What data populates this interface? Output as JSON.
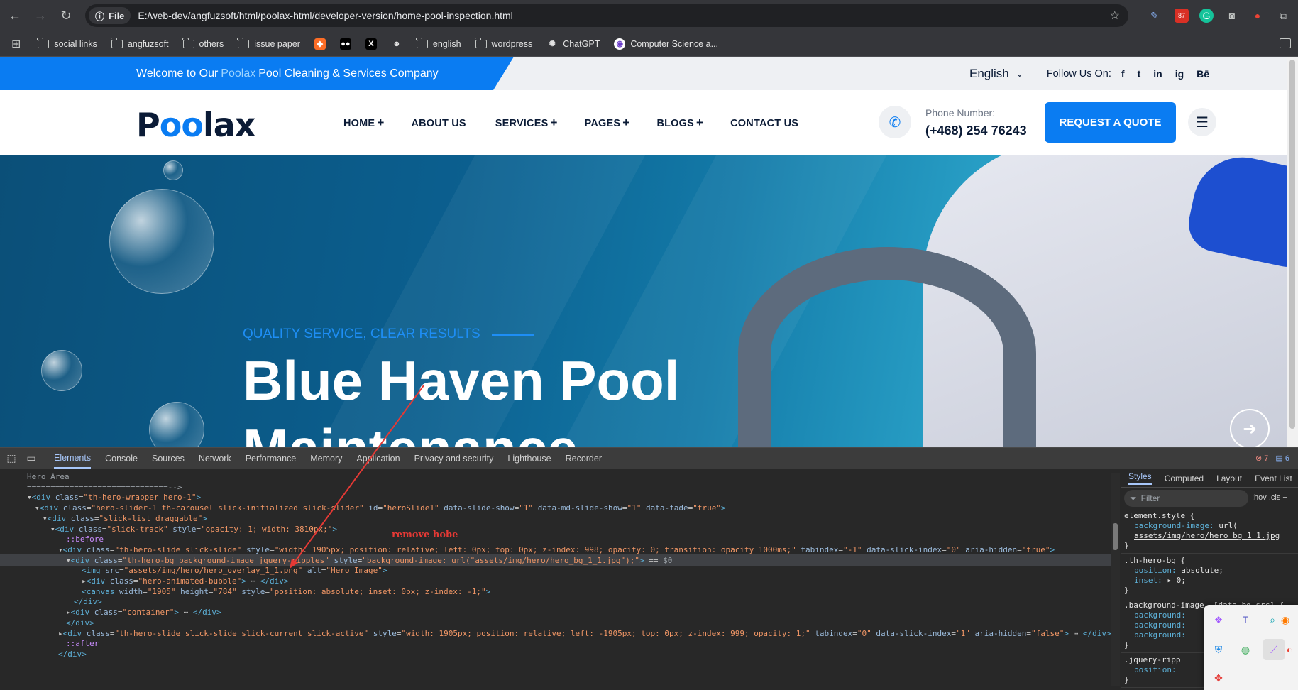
{
  "browser": {
    "file_chip": "File",
    "url": "E:/web-dev/angfuzsoft/html/poolax-html/developer-version/home-pool-inspection.html",
    "badge_count": "87",
    "bookmarks": [
      {
        "label": "social links",
        "icon": "folder-icon"
      },
      {
        "label": "angfuzsoft",
        "icon": "folder-icon"
      },
      {
        "label": "others",
        "icon": "folder-icon"
      },
      {
        "label": "issue paper",
        "icon": "folder-icon"
      },
      {
        "label": "",
        "icon": "gitlab-icon"
      },
      {
        "label": "",
        "icon": "medium-icon"
      },
      {
        "label": "",
        "icon": "x-icon"
      },
      {
        "label": "",
        "icon": "smiley-icon"
      },
      {
        "label": "english",
        "icon": "folder-icon"
      },
      {
        "label": "wordpress",
        "icon": "folder-icon"
      },
      {
        "label": "ChatGPT",
        "icon": "chatgpt-icon"
      },
      {
        "label": "Computer Science a...",
        "icon": "cs-icon"
      }
    ]
  },
  "site": {
    "topbar": {
      "welcome_before": "Welcome to Our",
      "brand_word": "Poolax",
      "welcome_after": "Pool Cleaning & Services Company",
      "language": "English",
      "follow_label": "Follow Us On:",
      "social": [
        "f",
        "t",
        "in",
        "ig",
        "Bē"
      ]
    },
    "logo": {
      "p": "P",
      "oo": "oo",
      "rest": "lax"
    },
    "nav": [
      {
        "label": "HOME",
        "plus": "+"
      },
      {
        "label": "ABOUT US",
        "plus": ""
      },
      {
        "label": "SERVICES",
        "plus": "+"
      },
      {
        "label": "PAGES",
        "plus": "+"
      },
      {
        "label": "BLOGS",
        "plus": "+"
      },
      {
        "label": "CONTACT US",
        "plus": ""
      }
    ],
    "phone_label": "Phone Number:",
    "phone_number": "(+468) 254 76243",
    "quote_button": "REQUEST A QUOTE",
    "hero": {
      "subtitle": "QUALITY SERVICE, CLEAR RESULTS",
      "title_line1": "Blue Haven Pool",
      "title_line2": "Maintenance"
    }
  },
  "annotation": {
    "text": "remove hobe",
    "color": "#e53935"
  },
  "devtools": {
    "tabs": [
      "Elements",
      "Console",
      "Sources",
      "Network",
      "Performance",
      "Memory",
      "Application",
      "Privacy and security",
      "Lighthouse",
      "Recorder"
    ],
    "active_tab": "Elements",
    "error_count": "7",
    "message_count": "6",
    "dom_lines": [
      {
        "indent": 4,
        "html": "<span class=\"cm\">Hero Area</span>"
      },
      {
        "indent": 4,
        "html": "<span class=\"cm\">==============================--></span>"
      },
      {
        "indent": 4,
        "html": "▾<span class=\"tg\">&lt;div</span> <span class=\"an\">class</span>=<span class=\"av\">\"th-hero-wrapper hero-1\"</span><span class=\"tg\">&gt;</span>"
      },
      {
        "indent": 5,
        "html": "▾<span class=\"tg\">&lt;div</span> <span class=\"an\">class</span>=<span class=\"av\">\"hero-slider-1 th-carousel slick-initialized slick-slider\"</span> <span class=\"an\">id</span>=<span class=\"av\">\"heroSlide1\"</span> <span class=\"an\">data-slide-show</span>=<span class=\"av\">\"1\"</span> <span class=\"an\">data-md-slide-show</span>=<span class=\"av\">\"1\"</span> <span class=\"an\">data-fade</span>=<span class=\"av\">\"true\"</span><span class=\"tg\">&gt;</span>"
      },
      {
        "indent": 6,
        "html": "▾<span class=\"tg\">&lt;div</span> <span class=\"an\">class</span>=<span class=\"av\">\"slick-list draggable\"</span><span class=\"tg\">&gt;</span>"
      },
      {
        "indent": 7,
        "html": "▾<span class=\"tg\">&lt;div</span> <span class=\"an\">class</span>=<span class=\"av\">\"slick-track\"</span> <span class=\"an\">style</span>=<span class=\"av\">\"opacity: 1; width: 3810px;\"</span><span class=\"tg\">&gt;</span>"
      },
      {
        "indent": 9,
        "html": "<span class=\"ps\">::before</span>"
      },
      {
        "indent": 8,
        "html": "▾<span class=\"tg\">&lt;div</span> <span class=\"an\">class</span>=<span class=\"av\">\"th-hero-slide slick-slide\"</span> <span class=\"an\">style</span>=<span class=\"av\">\"width: 1905px; position: relative; left: 0px; top: 0px; z-index: 998; opacity: 0; transition: opacity 1000ms;\"</span> <span class=\"an\">tabindex</span>=<span class=\"av\">\"-1\"</span> <span class=\"an\">data-slick-index</span>=<span class=\"av\">\"0\"</span> <span class=\"an\">aria-hidden</span>=<span class=\"av\">\"true\"</span><span class=\"tg\">&gt;</span>"
      },
      {
        "indent": 9,
        "html": "▾<span class=\"tg\">&lt;div</span> <span class=\"an\">class</span>=<span class=\"av\">\"th-hero-bg background-image jquery-ripples\"</span> <span class=\"an\">style</span>=<span class=\"av\">\"background-image: url(\"assets/img/hero/hero_bg_1_1.jpg\");\"</span><span class=\"tg\">&gt;</span> == <span class=\"cm\">$0</span>"
      },
      {
        "indent": 11,
        "html": "<span class=\"tg\">&lt;img</span> <span class=\"an\">src</span>=<span class=\"av\">\"</span><span class=\"lk\">assets/img/hero/hero_overlay_1_1.png</span><span class=\"av\">\"</span> <span class=\"an\">alt</span>=<span class=\"av\">\"Hero Image\"</span><span class=\"tg\">&gt;</span>"
      },
      {
        "indent": 11,
        "html": "▸<span class=\"tg\">&lt;div</span> <span class=\"an\">class</span>=<span class=\"av\">\"hero-animated-bubble\"</span><span class=\"tg\">&gt;</span> ⋯ <span class=\"tg\">&lt;/div&gt;</span>"
      },
      {
        "indent": 11,
        "html": "<span class=\"tg\">&lt;canvas</span> <span class=\"an\">width</span>=<span class=\"av\">\"1905\"</span> <span class=\"an\">height</span>=<span class=\"av\">\"784\"</span> <span class=\"an\">style</span>=<span class=\"av\">\"position: absolute; inset: 0px; z-index: -1;\"</span><span class=\"tg\">&gt;</span>"
      },
      {
        "indent": 10,
        "html": "<span class=\"tg\">&lt;/div&gt;</span>"
      },
      {
        "indent": 9,
        "html": "▸<span class=\"tg\">&lt;div</span> <span class=\"an\">class</span>=<span class=\"av\">\"container\"</span><span class=\"tg\">&gt;</span> ⋯ <span class=\"tg\">&lt;/div&gt;</span>"
      },
      {
        "indent": 9,
        "html": "<span class=\"tg\">&lt;/div&gt;</span>"
      },
      {
        "indent": 8,
        "html": "▸<span class=\"tg\">&lt;div</span> <span class=\"an\">class</span>=<span class=\"av\">\"th-hero-slide slick-slide slick-current slick-active\"</span> <span class=\"an\">style</span>=<span class=\"av\">\"width: 1905px; position: relative; left: -1905px; top: 0px; z-index: 999; opacity: 1;\"</span> <span class=\"an\">tabindex</span>=<span class=\"av\">\"0\"</span> <span class=\"an\">data-slick-index</span>=<span class=\"av\">\"1\"</span> <span class=\"an\">aria-hidden</span>=<span class=\"av\">\"false\"</span><span class=\"tg\">&gt;</span> ⋯ <span class=\"tg\">&lt;/div&gt;</span>"
      },
      {
        "indent": 9,
        "html": "<span class=\"ps\">::after</span>"
      },
      {
        "indent": 8,
        "html": "<span class=\"tg\">&lt;/div&gt;</span>"
      }
    ],
    "styles_tabs": [
      "Styles",
      "Computed",
      "Layout",
      "Event List"
    ],
    "filter_placeholder": "Filter",
    "filter_right": ":hov .cls +",
    "rules": [
      {
        "selector": "element.style {",
        "props": [
          [
            "background-image",
            "url("
          ],
          [
            "",
            "assets/img/hero/hero_bg_1_1.jpg"
          ]
        ]
      },
      {
        "selector": ".th-hero-bg {",
        "props": [
          [
            "position",
            "absolute;"
          ],
          [
            "inset",
            "▸ 0;"
          ]
        ]
      },
      {
        "selector": ".background-image, [data-bg-src] {",
        "props": [
          [
            "background",
            ""
          ],
          [
            "background",
            ""
          ],
          [
            "background",
            ""
          ]
        ]
      },
      {
        "selector": ".jquery-ripp",
        "props": [
          [
            "position",
            ""
          ]
        ]
      }
    ]
  }
}
